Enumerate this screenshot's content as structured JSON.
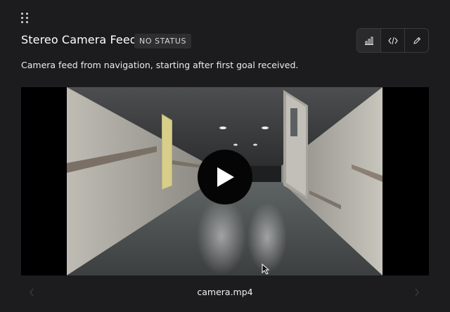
{
  "panel": {
    "title": "Stereo Camera Feed",
    "status_badge": "NO STATUS",
    "description": "Camera feed from navigation, starting after first goal received."
  },
  "toolbar": {
    "buttons": [
      {
        "icon": "bar-chart-icon",
        "active": true
      },
      {
        "icon": "code-icon",
        "active": false
      },
      {
        "icon": "pencil-icon",
        "active": false
      }
    ]
  },
  "media": {
    "filename": "camera.mp4",
    "state": "paused"
  },
  "colors": {
    "background": "#1c1c1e",
    "badge_background": "#2e2e31",
    "border": "#3a3a3e",
    "letterbox": "#000000"
  }
}
